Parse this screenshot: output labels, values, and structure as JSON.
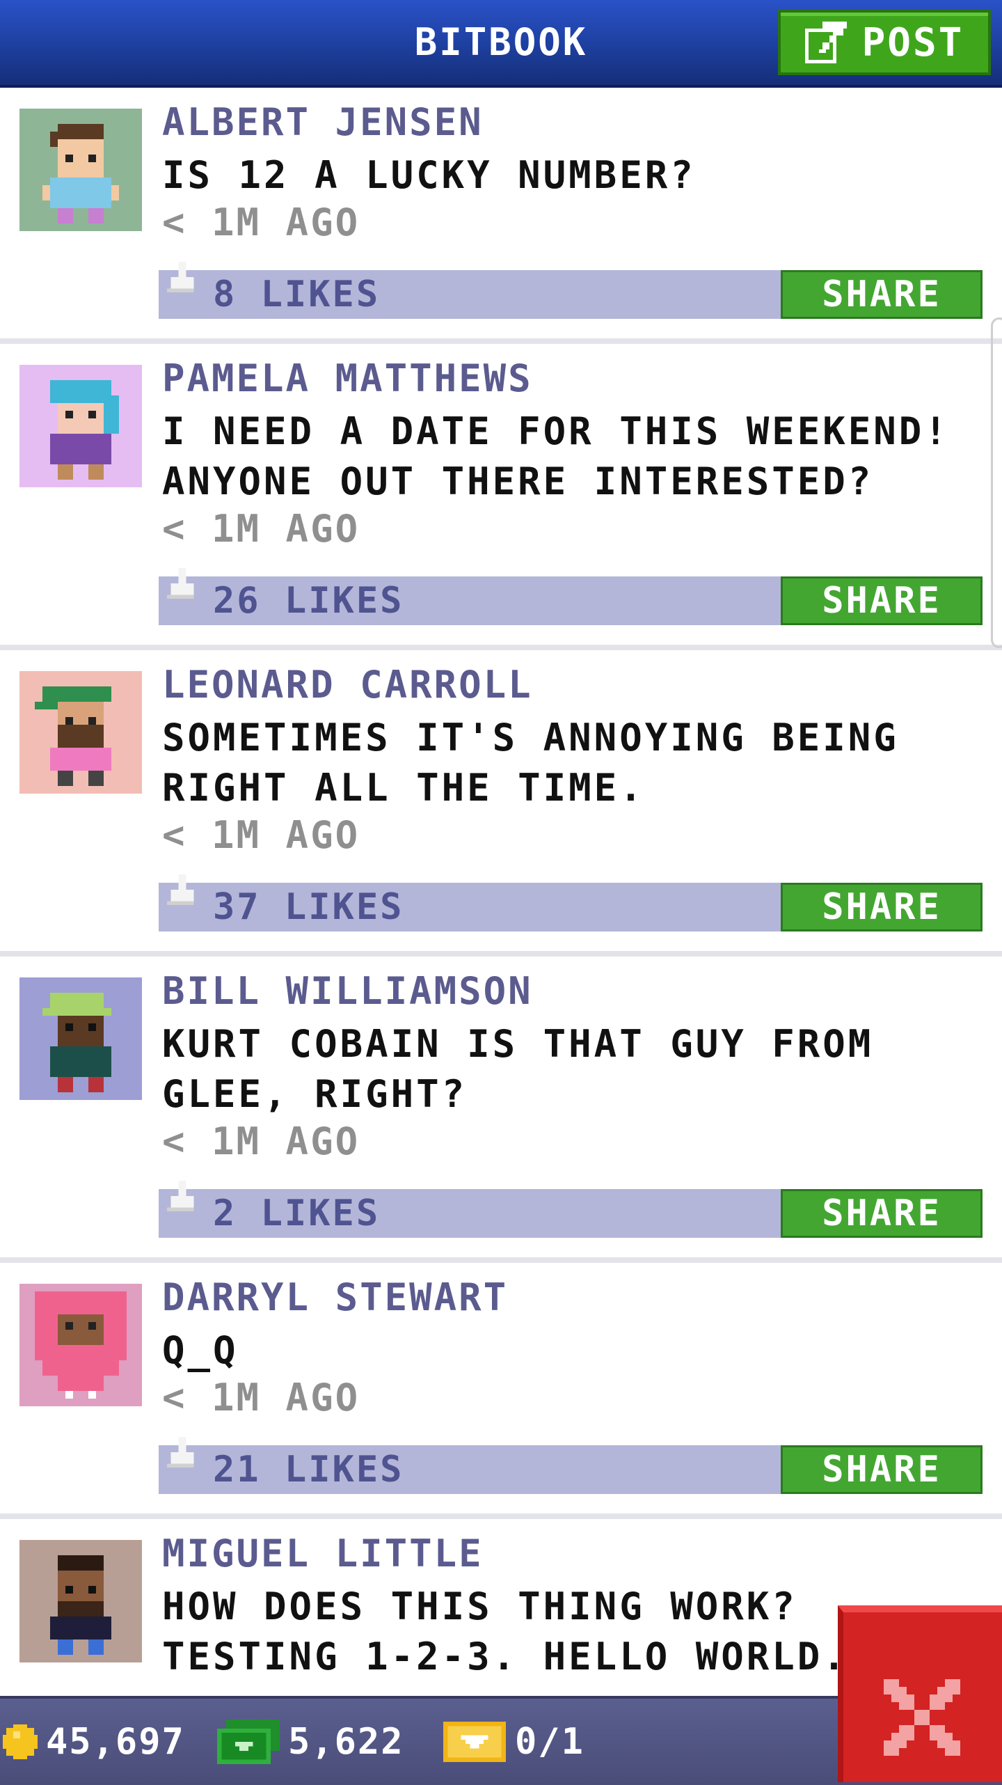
{
  "header": {
    "title": "BITBOOK",
    "post_label": "POST"
  },
  "posts": [
    {
      "author": "ALBERT JENSEN",
      "message": "IS 12 A LUCKY NUMBER?",
      "time": "< 1M AGO",
      "likes": "8 LIKES",
      "share_label": "SHARE"
    },
    {
      "author": "PAMELA MATTHEWS",
      "message": "I NEED A DATE FOR THIS WEEKEND! ANYONE OUT THERE INTERESTED?",
      "time": "< 1M AGO",
      "likes": "26 LIKES",
      "share_label": "SHARE"
    },
    {
      "author": "LEONARD CARROLL",
      "message": "SOMETIMES IT'S ANNOYING BEING RIGHT ALL THE TIME.",
      "time": "< 1M AGO",
      "likes": "37 LIKES",
      "share_label": "SHARE"
    },
    {
      "author": "BILL WILLIAMSON",
      "message": "KURT COBAIN IS THAT GUY FROM GLEE, RIGHT?",
      "time": "< 1M AGO",
      "likes": "2 LIKES",
      "share_label": "SHARE"
    },
    {
      "author": "DARRYL STEWART",
      "message": "Q_Q",
      "time": "< 1M AGO",
      "likes": "21 LIKES",
      "share_label": "SHARE"
    },
    {
      "author": "MIGUEL LITTLE",
      "message": "HOW DOES THIS THING WORK? TESTING 1-2-3. HELLO WORLD.",
      "time": "",
      "likes": "",
      "share_label": ""
    }
  ],
  "stats": {
    "coins": "45,697",
    "bux": "5,622",
    "tickets": "0/1"
  },
  "colors": {
    "header": "#1d3f9e",
    "post_button": "#3fa61c",
    "share_button": "#43a631",
    "like_bar": "#b3b6d8",
    "author_text": "#5b5b8f",
    "bottom_bar": "#4a4d78",
    "close_button": "#d32323"
  },
  "icons": {
    "post": "edit-icon",
    "like": "thumbs-up-icon",
    "coin": "coin-icon",
    "bux": "cash-icon",
    "ticket": "ticket-icon",
    "close": "close-icon"
  }
}
